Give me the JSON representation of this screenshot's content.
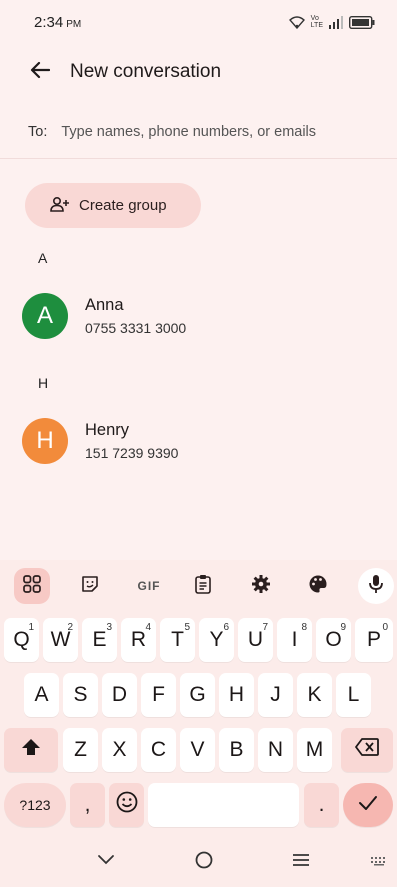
{
  "status_bar": {
    "time": "2:34",
    "ampm": "PM",
    "network_label_top": "Vo",
    "network_label_bottom": "LTE"
  },
  "app_bar": {
    "title": "New conversation",
    "back_icon": "arrow-back-icon"
  },
  "recipient": {
    "label": "To:",
    "placeholder": "Type names, phone numbers, or emails",
    "value": ""
  },
  "create_group": {
    "label": "Create group",
    "icon": "group-add-icon"
  },
  "contacts": {
    "sections": [
      {
        "letter": "A",
        "items": [
          {
            "initial": "A",
            "name": "Anna",
            "phone": "0755 3331 3000",
            "color": "#1e8e3e"
          }
        ]
      },
      {
        "letter": "H",
        "items": [
          {
            "initial": "H",
            "name": "Henry",
            "phone": "151 7239 9390",
            "color": "#f28b3b"
          }
        ]
      }
    ]
  },
  "keyboard": {
    "toolbar": [
      "apps-grid-icon",
      "sticker-icon",
      "gif-icon",
      "clipboard-icon",
      "settings-gear-icon",
      "palette-icon",
      "microphone-icon"
    ],
    "gif_label": "GIF",
    "row1": [
      {
        "k": "Q",
        "s": "1"
      },
      {
        "k": "W",
        "s": "2"
      },
      {
        "k": "E",
        "s": "3"
      },
      {
        "k": "R",
        "s": "4"
      },
      {
        "k": "T",
        "s": "5"
      },
      {
        "k": "Y",
        "s": "6"
      },
      {
        "k": "U",
        "s": "7"
      },
      {
        "k": "I",
        "s": "8"
      },
      {
        "k": "O",
        "s": "9"
      },
      {
        "k": "P",
        "s": "0"
      }
    ],
    "row2": [
      "A",
      "S",
      "D",
      "F",
      "G",
      "H",
      "J",
      "K",
      "L"
    ],
    "row3": [
      "Z",
      "X",
      "C",
      "V",
      "B",
      "N",
      "M"
    ],
    "symbols_label": "?123",
    "comma": ",",
    "period": "."
  },
  "colors": {
    "background": "#fdf1f0",
    "accent_pill": "#f9d8d5",
    "enter_key": "#f6b7b1"
  }
}
